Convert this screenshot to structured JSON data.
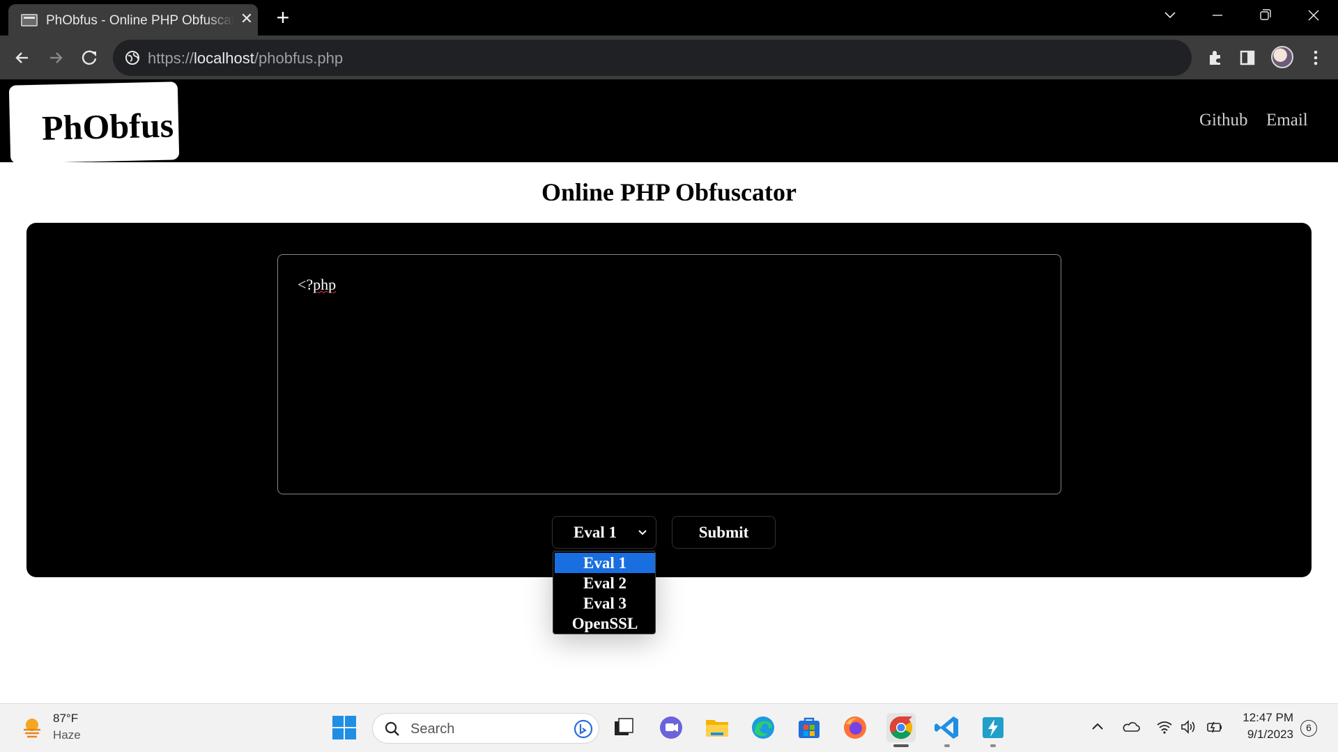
{
  "browser": {
    "tab_title": "PhObfus - Online PHP Obfuscator",
    "tab_close": "✕",
    "new_tab": "+",
    "url_scheme": "https://",
    "url_host": "localhost",
    "url_path": "/phobfus.php"
  },
  "site": {
    "logo": "PhObfus",
    "nav": [
      "Github",
      "Email"
    ],
    "title": "Online PHP Obfuscator"
  },
  "editor": {
    "code_prefix": "<?",
    "code_squiggle": "php"
  },
  "form": {
    "selected_method": "Eval 1",
    "submit_label": "Submit",
    "options": [
      "Eval 1",
      "Eval 2",
      "Eval 3",
      "OpenSSL"
    ],
    "highlight_color": "#1a6fe0"
  },
  "taskbar": {
    "weather_temp": "87°F",
    "weather_cond": "Haze",
    "search_placeholder": "Search",
    "time": "12:47 PM",
    "date": "9/1/2023",
    "notification_count": "6"
  },
  "icons": [
    "favicon-icon",
    "close-icon",
    "new-tab-icon",
    "chevron-down-icon",
    "minimize-icon",
    "restore-icon",
    "back-icon",
    "forward-icon",
    "reload-icon",
    "site-info-icon",
    "extensions-icon",
    "side-panel-icon",
    "menu-icon",
    "weather-icon",
    "windows-start-icon",
    "search-icon",
    "bing-icon",
    "task-view-icon",
    "teams-icon",
    "file-explorer-icon",
    "edge-icon",
    "store-icon",
    "firefox-icon",
    "chrome-icon",
    "vscode-icon",
    "app-icon",
    "tray-chevron-icon",
    "onedrive-icon",
    "wifi-icon",
    "volume-icon",
    "battery-icon"
  ]
}
